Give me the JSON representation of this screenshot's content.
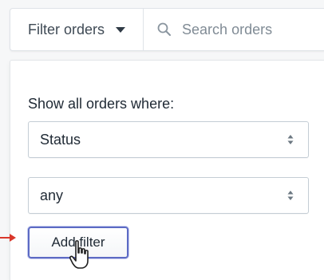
{
  "toolbar": {
    "filter_label": "Filter orders",
    "search_placeholder": "Search orders",
    "filter_icon": "caret-down-icon",
    "search_icon": "search-icon"
  },
  "filter_panel": {
    "heading": "Show all orders where:",
    "field_select": {
      "value": "Status"
    },
    "value_select": {
      "value": "any"
    },
    "add_button_label": "Add filter"
  },
  "colors": {
    "accent": "#5c6ac4",
    "pointer_arrow": "#d9372b"
  }
}
